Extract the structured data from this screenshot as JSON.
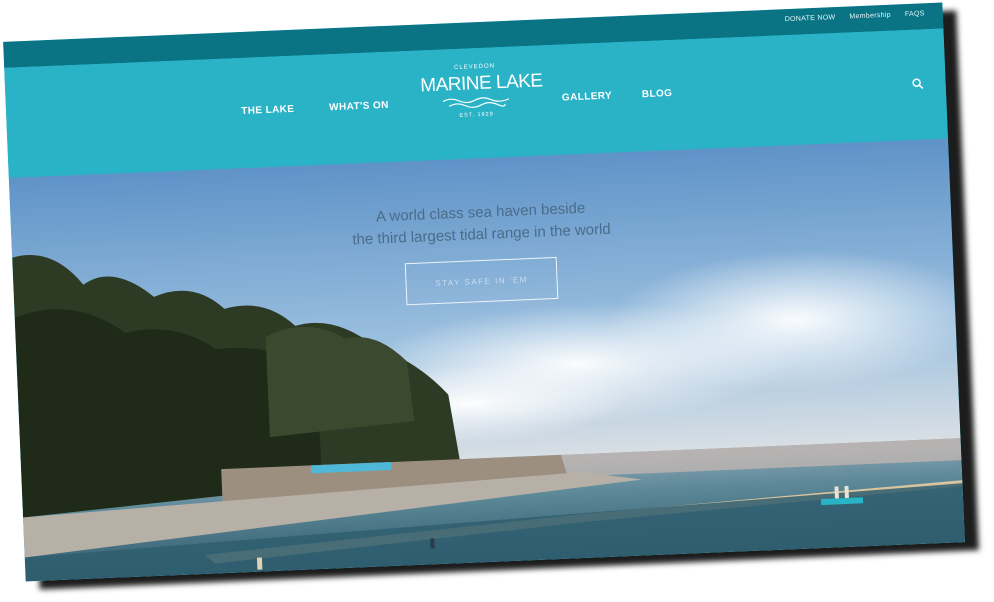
{
  "topbar": {
    "donate_label": "DONATE NOW",
    "membership_label": "Membership",
    "faqs_label": "FAQS"
  },
  "nav": {
    "lake_label": "THE LAKE",
    "whats_on_label": "WHAT'S ON",
    "gallery_label": "GALLERY",
    "blog_label": "BLOG"
  },
  "logo": {
    "top": "CLEVEDON",
    "main": "MARINE LAKE",
    "bottom": "EST. 1929"
  },
  "hero": {
    "tagline_line1": "A world class sea haven beside",
    "tagline_line2": "the third largest tidal range in the world",
    "cta_label": "STAY SAFE IN 'EM"
  },
  "colors": {
    "topbar": "#0a7485",
    "nav": "#2ab2c6",
    "sky_top": "#5f93c8",
    "water": "#3b6d80"
  },
  "icons": {
    "search": "search-icon",
    "logo_waves": "waves-icon"
  }
}
